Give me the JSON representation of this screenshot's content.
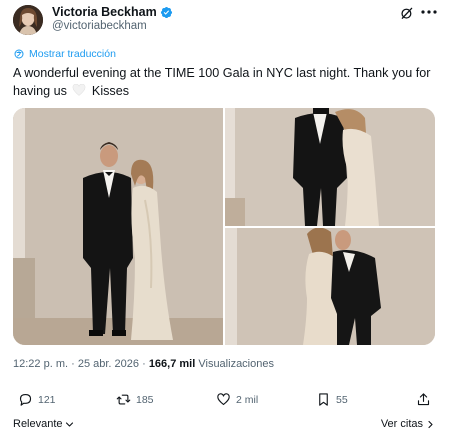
{
  "author": {
    "name": "Victoria Beckham",
    "handle": "@victoriabeckham"
  },
  "translate_label": "Mostrar traducción",
  "tweet": {
    "text_part1": "A wonderful evening at the TIME 100 Gala in NYC last night. Thank you for having us",
    "text_part2": "Kisses"
  },
  "meta": {
    "time": "12:22 p. m.",
    "separator1": "·",
    "date": "25 abr. 2026",
    "separator2": "·",
    "views_count": "166,7 mil",
    "views_label": "Visualizaciones"
  },
  "actions": {
    "replies": "121",
    "reposts": "185",
    "likes": "2 mil",
    "bookmarks": "55"
  },
  "footer": {
    "sort_label": "Relevante",
    "quotes_label": "Ver citas"
  },
  "colors": {
    "accent": "#1d9bf0",
    "muted": "#536471",
    "text": "#0f1419"
  },
  "icons": [
    "verified-badge-icon",
    "grok-icon",
    "more-icon",
    "translate-icon",
    "heart-emoji-icon",
    "reply-icon",
    "repost-icon",
    "like-icon",
    "bookmark-icon",
    "share-icon",
    "chevron-down-icon",
    "chevron-right-icon"
  ]
}
